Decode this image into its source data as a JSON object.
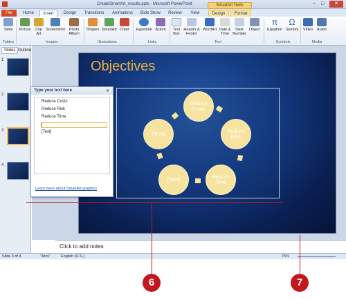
{
  "window": {
    "title": "CreateSmartArt_results.pptx - Microsoft PowerPoint",
    "tools_header": "SmartArt Tools"
  },
  "tabs": [
    "File",
    "Home",
    "Insert",
    "Design",
    "Transitions",
    "Animations",
    "Slide Show",
    "Review",
    "View",
    "Design",
    "Format"
  ],
  "ribbon": {
    "buttons": [
      {
        "label": "Table"
      },
      {
        "label": "Picture"
      },
      {
        "label": "Clip Art"
      },
      {
        "label": "Screenshot"
      },
      {
        "label": "Photo Album"
      },
      {
        "label": "Shapes"
      },
      {
        "label": "SmartArt"
      },
      {
        "label": "Chart"
      },
      {
        "label": "Hyperlink"
      },
      {
        "label": "Action"
      },
      {
        "label": "Text Box"
      },
      {
        "label": "Header & Footer"
      },
      {
        "label": "WordArt"
      },
      {
        "label": "Date & Time"
      },
      {
        "label": "Slide Number"
      },
      {
        "label": "Object"
      },
      {
        "label": "Equation"
      },
      {
        "label": "Symbol"
      },
      {
        "label": "Video"
      },
      {
        "label": "Audio"
      }
    ],
    "groups": [
      "Tables",
      "Images",
      "Illustrations",
      "Links",
      "Text",
      "Symbols",
      "Media"
    ]
  },
  "pane_tabs": [
    "Slides",
    "Outline"
  ],
  "slide_numbers": [
    "1",
    "2",
    "3",
    "4"
  ],
  "slide": {
    "title": "Objectives"
  },
  "smartart": {
    "nodes": [
      "Reduce Costs",
      "Reduce Risk",
      "Reduce Time",
      "[Text]",
      "[Text]"
    ]
  },
  "text_pane": {
    "title": "Type your text here",
    "items": [
      "Reduce Costs",
      "Reduce Risk",
      "Reduce Time",
      "|",
      "[Text]"
    ],
    "link": "Learn more about SmartArt graphics"
  },
  "notes": {
    "placeholder": "Click to add notes"
  },
  "status": {
    "slide": "Slide 3 of 4",
    "theme": "\"Arcs\"",
    "language": "English (U.S.)",
    "zoom": "75%"
  },
  "callouts": [
    "6",
    "7"
  ]
}
